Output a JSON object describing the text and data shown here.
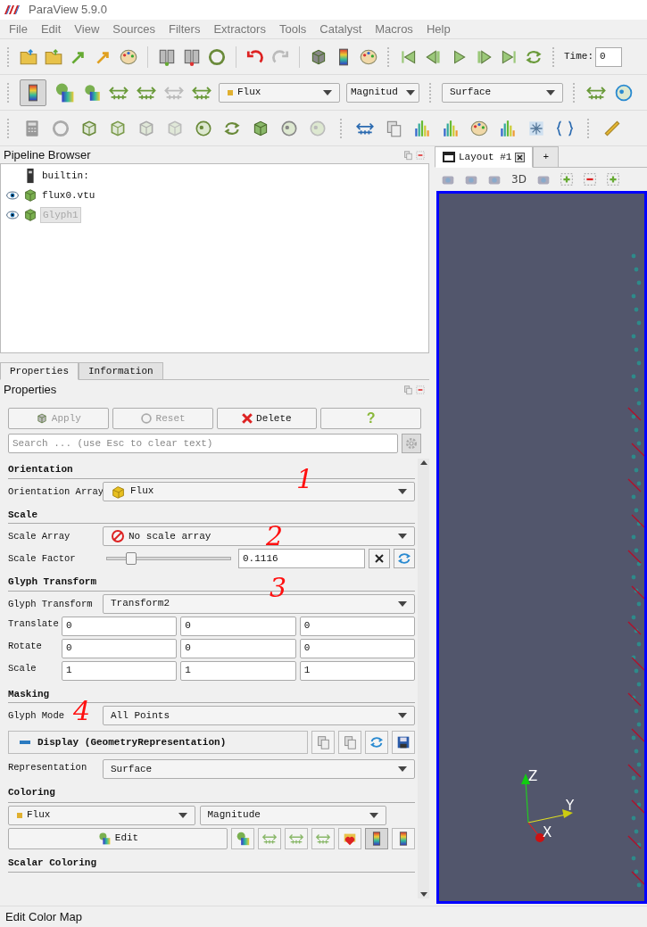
{
  "window": {
    "title": "ParaView 5.9.0"
  },
  "menu": [
    "File",
    "Edit",
    "View",
    "Sources",
    "Filters",
    "Extractors",
    "Tools",
    "Catalyst",
    "Macros",
    "Help"
  ],
  "toolbar": {
    "time_label": "Time:",
    "time_value": "0",
    "color_array": "Flux",
    "component": "Magnitud",
    "representation": "Surface",
    "color_legend_visible": true
  },
  "pipeline_browser": {
    "title": "Pipeline Browser",
    "items": [
      {
        "label": "builtin:",
        "kind": "server",
        "selected": false
      },
      {
        "label": "flux0.vtu",
        "kind": "source",
        "visible": true,
        "selected": false
      },
      {
        "label": "Glyph1",
        "kind": "source",
        "visible": true,
        "selected": true
      }
    ]
  },
  "tabs": [
    {
      "label": "Properties",
      "selected": true
    },
    {
      "label": "Information",
      "selected": false
    }
  ],
  "properties": {
    "title": "Properties",
    "buttons": [
      {
        "label": "Apply",
        "kind": "apply",
        "disabled": true
      },
      {
        "label": "Reset",
        "kind": "reset",
        "disabled": true
      },
      {
        "label": "Delete",
        "kind": "delete",
        "disabled": false
      },
      {
        "label": "?",
        "kind": "help",
        "disabled": false
      }
    ],
    "search": {
      "placeholder": "Search ... (use Esc to clear text)"
    },
    "sections": [
      {
        "title": "Orientation",
        "rows": [
          {
            "kind": "vector",
            "label": "Orientation Array",
            "value": "Flux"
          }
        ]
      },
      {
        "title": "Scale",
        "rows": [
          {
            "kind": "unset",
            "label": "Scale Array",
            "value": "No scale array"
          },
          {
            "kind": "slider",
            "label": "Scale Factor",
            "level": 0.2,
            "value": "0.1116"
          }
        ]
      },
      {
        "title": "Glyph Transform",
        "rows": [
          {
            "kind": "dropdown",
            "label": "Glyph Transform",
            "value": "Transform2"
          },
          {
            "kind": "triple",
            "label": "Translate",
            "values": [
              "0",
              "0",
              "0"
            ]
          },
          {
            "kind": "triple",
            "label": "Rotate",
            "values": [
              "0",
              "0",
              "0"
            ]
          },
          {
            "kind": "triple",
            "label": "Scale",
            "values": [
              "1",
              "1",
              "1"
            ]
          }
        ]
      },
      {
        "title": "Masking",
        "rows": [
          {
            "kind": "dropdown",
            "label": "Glyph Mode",
            "value": "All Points"
          }
        ]
      }
    ],
    "display": {
      "title": "Display (GeometryRepresentation)",
      "expanded": true,
      "representation_label": "Representation",
      "representation": "Surface"
    },
    "coloring": {
      "title": "Coloring",
      "array": "Flux",
      "component": "Magnitude",
      "edit_label": "Edit",
      "color_legend_visible": true
    },
    "scalar_coloring": {
      "title": "Scalar Coloring"
    }
  },
  "annotations": [
    "1",
    "2",
    "3",
    "4"
  ],
  "layout_tabs": [
    {
      "label": "Layout #1",
      "selected": true
    },
    {
      "label": "+",
      "selected": false
    }
  ],
  "view_toolbar": {
    "mode": "3D"
  },
  "view": {
    "z_label": "Z",
    "y_label": "Y",
    "x_label": "X"
  },
  "status_bar": {
    "text": "Edit Color Map"
  }
}
